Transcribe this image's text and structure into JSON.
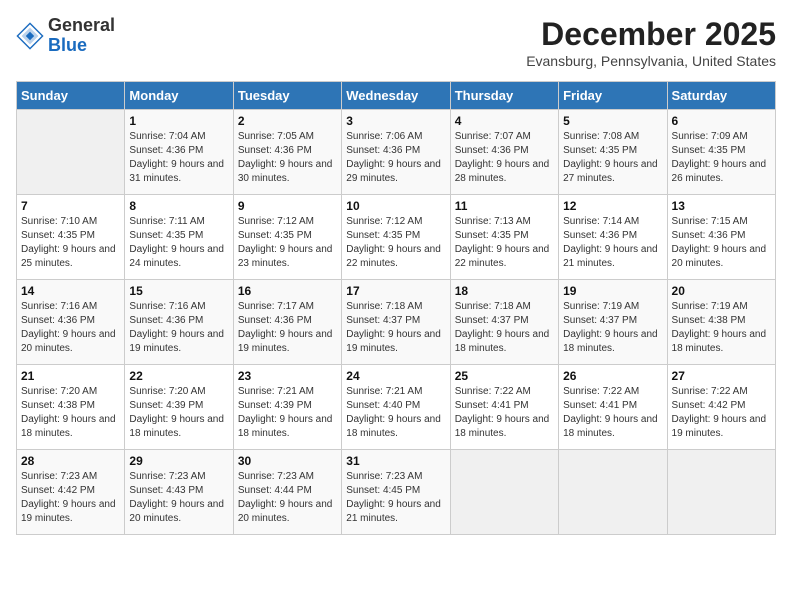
{
  "header": {
    "logo_line1": "General",
    "logo_line2": "Blue",
    "month_year": "December 2025",
    "location": "Evansburg, Pennsylvania, United States"
  },
  "weekdays": [
    "Sunday",
    "Monday",
    "Tuesday",
    "Wednesday",
    "Thursday",
    "Friday",
    "Saturday"
  ],
  "weeks": [
    [
      {
        "day": "",
        "sunrise": "",
        "sunset": "",
        "daylight": ""
      },
      {
        "day": "1",
        "sunrise": "7:04 AM",
        "sunset": "4:36 PM",
        "daylight": "9 hours and 31 minutes."
      },
      {
        "day": "2",
        "sunrise": "7:05 AM",
        "sunset": "4:36 PM",
        "daylight": "9 hours and 30 minutes."
      },
      {
        "day": "3",
        "sunrise": "7:06 AM",
        "sunset": "4:36 PM",
        "daylight": "9 hours and 29 minutes."
      },
      {
        "day": "4",
        "sunrise": "7:07 AM",
        "sunset": "4:36 PM",
        "daylight": "9 hours and 28 minutes."
      },
      {
        "day": "5",
        "sunrise": "7:08 AM",
        "sunset": "4:35 PM",
        "daylight": "9 hours and 27 minutes."
      },
      {
        "day": "6",
        "sunrise": "7:09 AM",
        "sunset": "4:35 PM",
        "daylight": "9 hours and 26 minutes."
      }
    ],
    [
      {
        "day": "7",
        "sunrise": "7:10 AM",
        "sunset": "4:35 PM",
        "daylight": "9 hours and 25 minutes."
      },
      {
        "day": "8",
        "sunrise": "7:11 AM",
        "sunset": "4:35 PM",
        "daylight": "9 hours and 24 minutes."
      },
      {
        "day": "9",
        "sunrise": "7:12 AM",
        "sunset": "4:35 PM",
        "daylight": "9 hours and 23 minutes."
      },
      {
        "day": "10",
        "sunrise": "7:12 AM",
        "sunset": "4:35 PM",
        "daylight": "9 hours and 22 minutes."
      },
      {
        "day": "11",
        "sunrise": "7:13 AM",
        "sunset": "4:35 PM",
        "daylight": "9 hours and 22 minutes."
      },
      {
        "day": "12",
        "sunrise": "7:14 AM",
        "sunset": "4:36 PM",
        "daylight": "9 hours and 21 minutes."
      },
      {
        "day": "13",
        "sunrise": "7:15 AM",
        "sunset": "4:36 PM",
        "daylight": "9 hours and 20 minutes."
      }
    ],
    [
      {
        "day": "14",
        "sunrise": "7:16 AM",
        "sunset": "4:36 PM",
        "daylight": "9 hours and 20 minutes."
      },
      {
        "day": "15",
        "sunrise": "7:16 AM",
        "sunset": "4:36 PM",
        "daylight": "9 hours and 19 minutes."
      },
      {
        "day": "16",
        "sunrise": "7:17 AM",
        "sunset": "4:36 PM",
        "daylight": "9 hours and 19 minutes."
      },
      {
        "day": "17",
        "sunrise": "7:18 AM",
        "sunset": "4:37 PM",
        "daylight": "9 hours and 19 minutes."
      },
      {
        "day": "18",
        "sunrise": "7:18 AM",
        "sunset": "4:37 PM",
        "daylight": "9 hours and 18 minutes."
      },
      {
        "day": "19",
        "sunrise": "7:19 AM",
        "sunset": "4:37 PM",
        "daylight": "9 hours and 18 minutes."
      },
      {
        "day": "20",
        "sunrise": "7:19 AM",
        "sunset": "4:38 PM",
        "daylight": "9 hours and 18 minutes."
      }
    ],
    [
      {
        "day": "21",
        "sunrise": "7:20 AM",
        "sunset": "4:38 PM",
        "daylight": "9 hours and 18 minutes."
      },
      {
        "day": "22",
        "sunrise": "7:20 AM",
        "sunset": "4:39 PM",
        "daylight": "9 hours and 18 minutes."
      },
      {
        "day": "23",
        "sunrise": "7:21 AM",
        "sunset": "4:39 PM",
        "daylight": "9 hours and 18 minutes."
      },
      {
        "day": "24",
        "sunrise": "7:21 AM",
        "sunset": "4:40 PM",
        "daylight": "9 hours and 18 minutes."
      },
      {
        "day": "25",
        "sunrise": "7:22 AM",
        "sunset": "4:41 PM",
        "daylight": "9 hours and 18 minutes."
      },
      {
        "day": "26",
        "sunrise": "7:22 AM",
        "sunset": "4:41 PM",
        "daylight": "9 hours and 18 minutes."
      },
      {
        "day": "27",
        "sunrise": "7:22 AM",
        "sunset": "4:42 PM",
        "daylight": "9 hours and 19 minutes."
      }
    ],
    [
      {
        "day": "28",
        "sunrise": "7:23 AM",
        "sunset": "4:42 PM",
        "daylight": "9 hours and 19 minutes."
      },
      {
        "day": "29",
        "sunrise": "7:23 AM",
        "sunset": "4:43 PM",
        "daylight": "9 hours and 20 minutes."
      },
      {
        "day": "30",
        "sunrise": "7:23 AM",
        "sunset": "4:44 PM",
        "daylight": "9 hours and 20 minutes."
      },
      {
        "day": "31",
        "sunrise": "7:23 AM",
        "sunset": "4:45 PM",
        "daylight": "9 hours and 21 minutes."
      },
      {
        "day": "",
        "sunrise": "",
        "sunset": "",
        "daylight": ""
      },
      {
        "day": "",
        "sunrise": "",
        "sunset": "",
        "daylight": ""
      },
      {
        "day": "",
        "sunrise": "",
        "sunset": "",
        "daylight": ""
      }
    ]
  ]
}
